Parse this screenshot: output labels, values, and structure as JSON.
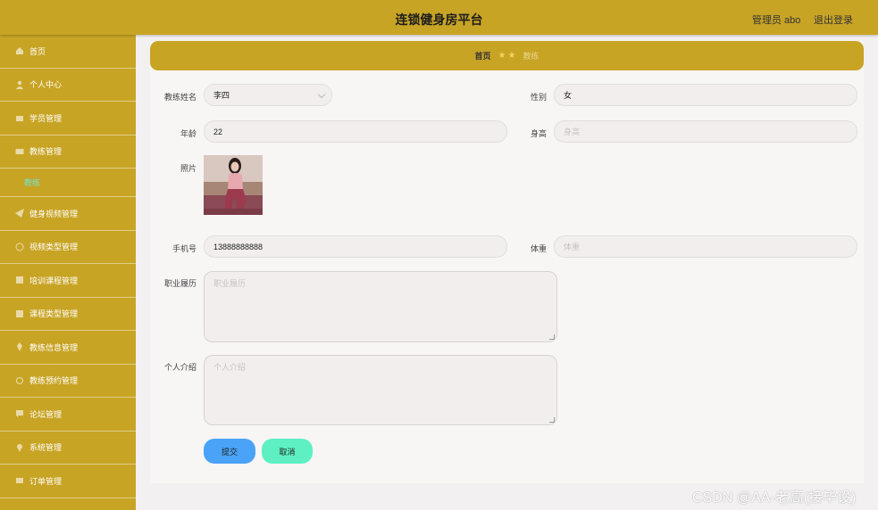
{
  "header": {
    "title": "连锁健身房平台",
    "user": "管理员 abo",
    "logout": "退出登录",
    "color": "#c8a425"
  },
  "sidebar": {
    "items": [
      {
        "label": "首页",
        "icon": "home-icon"
      },
      {
        "label": "个人中心",
        "icon": "user-icon"
      },
      {
        "label": "学员管理",
        "icon": "group-icon"
      },
      {
        "label": "教练管理",
        "icon": "id-card-icon"
      },
      {
        "label": "健身视频管理",
        "icon": "send-icon"
      },
      {
        "label": "视频类型管理",
        "icon": "clock-icon"
      },
      {
        "label": "培训课程管理",
        "icon": "grid-icon"
      },
      {
        "label": "课程类型管理",
        "icon": "grid-icon"
      },
      {
        "label": "教练信息管理",
        "icon": "pin-icon"
      },
      {
        "label": "教练预约管理",
        "icon": "refresh-icon"
      },
      {
        "label": "论坛管理",
        "icon": "chat-icon"
      },
      {
        "label": "系统管理",
        "icon": "location-icon"
      },
      {
        "label": "订单管理",
        "icon": "list-icon"
      }
    ],
    "sub_item": "教练",
    "accent": "#6ee6d0"
  },
  "breadcrumb": {
    "home": "首页",
    "current": "教练"
  },
  "form": {
    "name_label": "教练姓名",
    "name_value": "李四",
    "gender_label": "性别",
    "gender_value": "女",
    "age_label": "年龄",
    "age_value": "22",
    "height_label": "身高",
    "height_placeholder": "身高",
    "photo_label": "照片",
    "phone_label": "手机号",
    "phone_value": "13888888888",
    "weight_label": "体重",
    "weight_placeholder": "体重",
    "resume_label": "职业履历",
    "resume_placeholder": "职业履历",
    "intro_label": "个人介绍",
    "intro_placeholder": "个人介绍"
  },
  "buttons": {
    "submit": "提交",
    "cancel": "取消",
    "submit_color": "#4aa3f7",
    "cancel_color": "#5ef0c2"
  },
  "watermark": "CSDN @AA-老高(接毕设)"
}
